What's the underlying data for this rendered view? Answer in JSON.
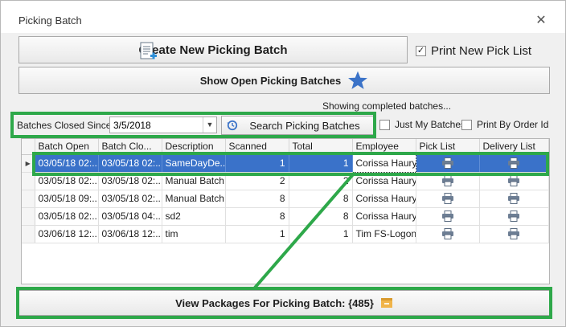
{
  "window": {
    "title": "Picking Batch",
    "close_glyph": "✕"
  },
  "toolbar": {
    "create_label": "Create New Picking Batch",
    "print_new_pick_list_label": "Print New Pick List",
    "print_new_pick_list_checked": true,
    "show_open_label": "Show Open Picking Batches"
  },
  "filter": {
    "status_text": "Showing completed batches...",
    "closed_since_label": "Batches Closed Since:",
    "closed_since_value": "3/5/2018",
    "search_label": "Search Picking Batches",
    "just_my_batches_label": "Just My Batches",
    "just_my_batches_checked": false,
    "print_by_order_id_label": "Print By Order Id",
    "print_by_order_id_checked": false
  },
  "grid": {
    "columns": [
      "Batch Open",
      "Batch Clo...",
      "Description",
      "Scanned",
      "Total",
      "Employee",
      "Pick List",
      "Delivery List"
    ],
    "selected_row": 0,
    "rows": [
      {
        "batch_open": "03/05/18 02:...",
        "batch_closed": "03/05/18 02:...",
        "description": "SameDayDe...",
        "scanned": "1",
        "total": "1",
        "employee": "Corissa Haury"
      },
      {
        "batch_open": "03/05/18 02:...",
        "batch_closed": "03/05/18 02:...",
        "description": "Manual Batch",
        "scanned": "2",
        "total": "2",
        "employee": "Corissa Haury"
      },
      {
        "batch_open": "03/05/18 09:...",
        "batch_closed": "03/05/18 02:...",
        "description": "Manual Batch",
        "scanned": "8",
        "total": "8",
        "employee": "Corissa Haury"
      },
      {
        "batch_open": "03/05/18 02:...",
        "batch_closed": "03/05/18 04:...",
        "description": "sd2",
        "scanned": "8",
        "total": "8",
        "employee": "Corissa Haury"
      },
      {
        "batch_open": "03/06/18 12:...",
        "batch_closed": "03/06/18 12:...",
        "description": "tim",
        "scanned": "1",
        "total": "1",
        "employee": "Tim FS-Logon"
      }
    ]
  },
  "footer": {
    "view_packages_label": "View Packages For Picking Batch: {485}"
  },
  "colors": {
    "highlight": "#2ea84a",
    "selection": "#3a72c9",
    "star": "#3b73c8",
    "package": "#f0b44a"
  },
  "icons": [
    "document-add-icon",
    "star-icon",
    "history-icon",
    "dropdown-arrow-icon",
    "printer-icon",
    "package-icon",
    "close-icon",
    "checkbox-icon",
    "row-indicator-icon"
  ]
}
